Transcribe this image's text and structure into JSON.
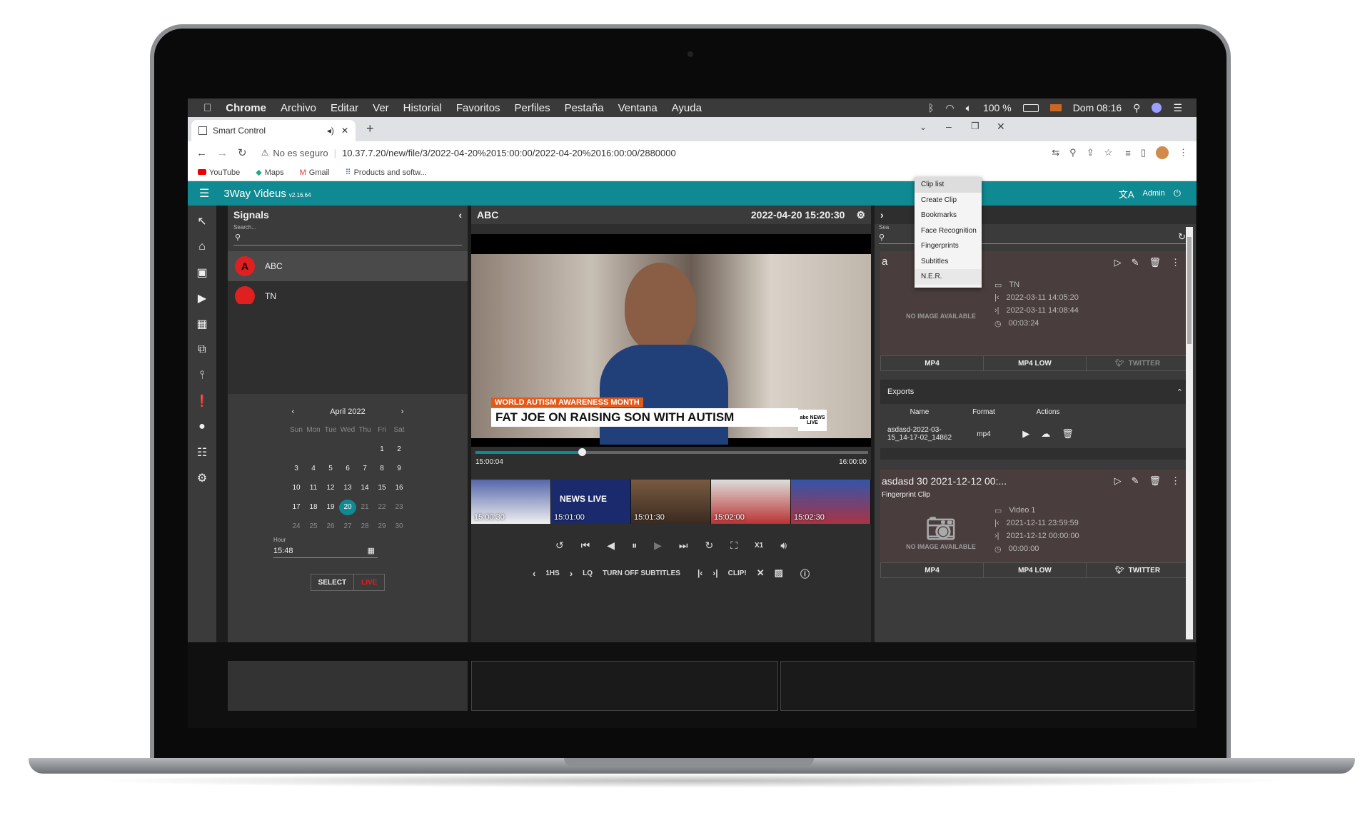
{
  "menubar": {
    "apple": "",
    "app": "Chrome",
    "items": [
      "Archivo",
      "Editar",
      "Ver",
      "Historial",
      "Favoritos",
      "Perfiles",
      "Pestaña",
      "Ventana",
      "Ayuda"
    ],
    "battery": "100 %",
    "clock": "Dom 08:16"
  },
  "browser": {
    "tab_title": "Smart Control",
    "security": "No es seguro",
    "url": "10.37.7.20/new/file/3/2022-04-20%2015:00:00/2022-04-20%2016:00:00/2880000",
    "bookmarks": [
      "YouTube",
      "Maps",
      "Gmail",
      "Products and softw..."
    ]
  },
  "app": {
    "name": "3Way Videus",
    "version": "v2.16.64",
    "user": "Admin",
    "accent": "#0f8a92"
  },
  "signals": {
    "title": "Signals",
    "search_label": "Search...",
    "items": [
      {
        "name": "ABC",
        "logo": "A"
      },
      {
        "name": "TN",
        "logo": ""
      }
    ]
  },
  "calendar": {
    "month": "April 2022",
    "weekdays": [
      "Sun",
      "Mon",
      "Tue",
      "Wed",
      "Thu",
      "Fri",
      "Sat"
    ],
    "weeks": [
      [
        "",
        "",
        "",
        "",
        "",
        "1",
        "2"
      ],
      [
        "3",
        "4",
        "5",
        "6",
        "7",
        "8",
        "9"
      ],
      [
        "10",
        "11",
        "12",
        "13",
        "14",
        "15",
        "16"
      ],
      [
        "17",
        "18",
        "19",
        "20",
        "21",
        "22",
        "23"
      ],
      [
        "24",
        "25",
        "26",
        "27",
        "28",
        "29",
        "30"
      ]
    ],
    "selected": "20",
    "hour_label": "Hour",
    "hour_value": "15:48",
    "select_button": "SELECT",
    "live_button": "LIVE"
  },
  "player": {
    "channel": "ABC",
    "datetime": "2022-04-20 15:20:30",
    "lower_third_top": "WORLD AUTISM AWARENESS MONTH",
    "lower_third_main": "FAT JOE ON RAISING SON WITH AUTISM",
    "bug": "abc NEWS LIVE",
    "timeline_start": "15:00:04",
    "timeline_end": "16:00:00",
    "progress": 0.27,
    "thumb_times": [
      "15:00:30",
      "15:01:00",
      "15:01:30",
      "15:02:00",
      "15:02:30"
    ],
    "thumb_overlay": "NEWS LIVE",
    "speed": "X1",
    "step": "1HS",
    "quality": "LQ",
    "subtitles": "TURN OFF SUBTITLES",
    "clip": "CLIP!"
  },
  "right": {
    "search_label": "Sea",
    "dropdown": [
      "Clip list",
      "Create Clip",
      "Bookmarks",
      "Face Recognition",
      "Fingerprints",
      "Subtitles",
      "N.E.R."
    ],
    "clip1": {
      "title_fragment": "a",
      "no_image": "NO IMAGE AVAILABLE",
      "source": "TN",
      "start": "2022-03-11 14:05:20",
      "end": "2022-03-11 14:08:44",
      "duration": "00:03:24",
      "formats": [
        "MP4",
        "MP4 LOW",
        "TWITTER"
      ]
    },
    "exports": {
      "title": "Exports",
      "columns": [
        "Name",
        "Format",
        "Actions"
      ],
      "rows": [
        {
          "name": "asdasd-2022-03-15_14-17-02_14862",
          "format": "mp4"
        }
      ]
    },
    "clip2": {
      "title": "asdasd 30 2021-12-12 00:...",
      "subtitle": "Fingerprint Clip",
      "no_image": "NO IMAGE AVAILABLE",
      "source": "Video 1",
      "start": "2021-12-11 23:59:59",
      "end": "2021-12-12 00:00:00",
      "duration": "00:00:00",
      "formats": [
        "MP4",
        "MP4 LOW",
        "TWITTER"
      ]
    }
  }
}
